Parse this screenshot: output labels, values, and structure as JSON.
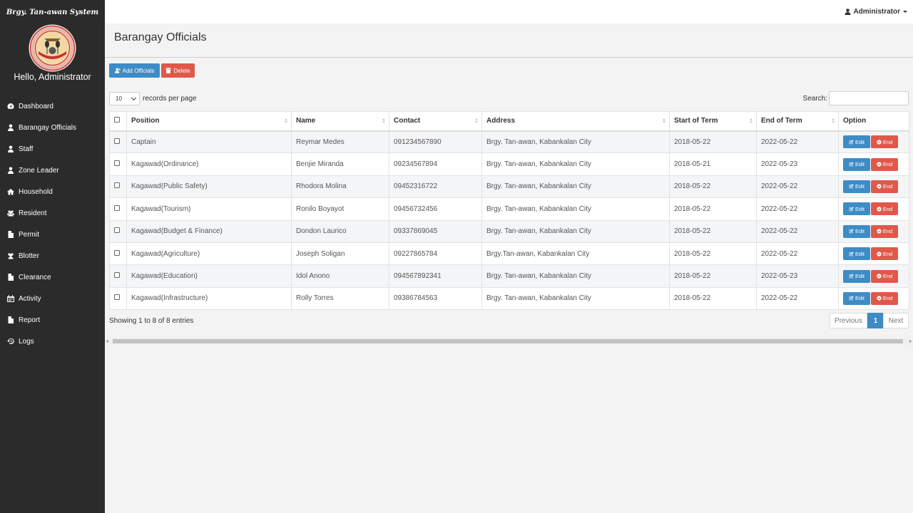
{
  "app": {
    "brand": "Brgy. Tan-awan System",
    "greeting": "Hello, Administrator",
    "logo_seal_text": "LUNGSOD NG KABANKALAN"
  },
  "topbar": {
    "user": "Administrator"
  },
  "sidebar": {
    "items": [
      {
        "label": "Dashboard",
        "icon": "dashboard-icon"
      },
      {
        "label": "Barangay Officials",
        "icon": "user-icon"
      },
      {
        "label": "Staff",
        "icon": "user-icon"
      },
      {
        "label": "Zone Leader",
        "icon": "user-icon"
      },
      {
        "label": "Household",
        "icon": "home-icon"
      },
      {
        "label": "Resident",
        "icon": "users-icon"
      },
      {
        "label": "Permit",
        "icon": "file-icon"
      },
      {
        "label": "Blotter",
        "icon": "users-icon"
      },
      {
        "label": "Clearance",
        "icon": "file-icon"
      },
      {
        "label": "Activity",
        "icon": "calendar-icon"
      },
      {
        "label": "Report",
        "icon": "file-icon"
      },
      {
        "label": "Logs",
        "icon": "history-icon"
      }
    ]
  },
  "page": {
    "title": "Barangay Officials"
  },
  "toolbar": {
    "add_label": "Add Officials",
    "delete_label": "Delete"
  },
  "table_controls": {
    "length_value": "10",
    "length_suffix": "records per page",
    "search_label": "Search:",
    "search_value": ""
  },
  "table": {
    "headers": [
      "Position",
      "Name",
      "Contact",
      "Address",
      "Start of Term",
      "End of Term",
      "Option"
    ],
    "rows": [
      {
        "position": "Captain",
        "name": "Reymar Medes",
        "contact": "091234567890",
        "address": "Brgy. Tan-awan, Kabankalan City",
        "start": "2018-05-22",
        "end": "2022-05-22"
      },
      {
        "position": "Kagawad(Ordinance)",
        "name": "Benjie Miranda",
        "contact": "09234567894",
        "address": "Brgy. Tan-awan, Kabankalan City",
        "start": "2018-05-21",
        "end": "2022-05-23"
      },
      {
        "position": "Kagawad(Public Safety)",
        "name": "Rhodora Molina",
        "contact": "09452316722",
        "address": "Brgy. Tan-awan, Kabankalan City",
        "start": "2018-05-22",
        "end": "2022-05-22"
      },
      {
        "position": "Kagawad(Tourism)",
        "name": "Ronilo Boyayot",
        "contact": "09456732456",
        "address": "Brgy. Tan-awan, Kabankalan City",
        "start": "2018-05-22",
        "end": "2022-05-22"
      },
      {
        "position": "Kagawad(Budget & Finance)",
        "name": "Dondon Laurico",
        "contact": "09337869045",
        "address": "Brgy. Tan-awan, Kabankalan City",
        "start": "2018-05-22",
        "end": "2022-05-22"
      },
      {
        "position": "Kagawad(Agriculture)",
        "name": "Joseph Soligan",
        "contact": "09227865784",
        "address": "Brgy.Tan-awan, Kabankalan City",
        "start": "2018-05-22",
        "end": "2022-05-22"
      },
      {
        "position": "Kagawad(Education)",
        "name": "Idol Anono",
        "contact": "094567892341",
        "address": "Brgy. Tan-awan, Kabankalan City",
        "start": "2018-05-22",
        "end": "2022-05-23"
      },
      {
        "position": "Kagawad(Infrastructure)",
        "name": "Rolly Torres",
        "contact": "09386784563",
        "address": "Brgy. Tan-awan, Kabankalan City",
        "start": "2018-05-22",
        "end": "2022-05-22"
      }
    ],
    "edit_label": "Edit",
    "end_label": "End"
  },
  "footer": {
    "info": "Showing 1 to 8 of 8 entries",
    "prev_label": "Previous",
    "page_label": "1",
    "next_label": "Next"
  },
  "colors": {
    "primary": "#3d8cc6",
    "danger": "#e0584a",
    "sidebar": "#2b2b2b"
  }
}
